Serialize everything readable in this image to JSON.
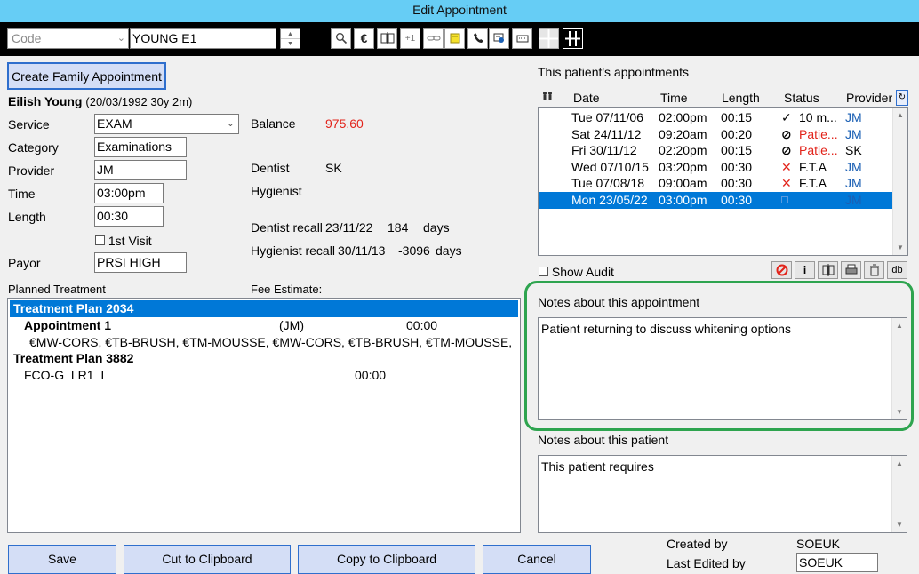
{
  "window": {
    "title": "Edit Appointment"
  },
  "toolbar": {
    "code_placeholder": "Code",
    "patient_search": "YOUNG E1",
    "icons": [
      "search-icon",
      "euro-icon",
      "split-icon",
      "plus-one-icon",
      "link-icon",
      "note-icon",
      "phone-icon",
      "card-icon",
      "keyboard-icon",
      "grid-icon",
      "columns-icon"
    ],
    "euro_glyph": "€",
    "plus_one": "+1"
  },
  "left": {
    "create_family_label": "Create Family Appointment",
    "patient_name": "Eilish Young",
    "patient_dob": "(20/03/1992 30y 2m)",
    "service_label": "Service",
    "service_value": "EXAM",
    "category_label": "Category",
    "category_value": "Examinations",
    "provider_label": "Provider",
    "provider_value": "JM",
    "time_label": "Time",
    "time_value": "03:00pm",
    "length_label": "Length",
    "length_value": "00:30",
    "first_visit_label": "1st Visit",
    "payor_label": "Payor",
    "payor_value": "PRSI HIGH",
    "balance_label": "Balance",
    "balance_value": "975.60",
    "balance_color": "#e2231a",
    "dentist_label": "Dentist",
    "dentist_value": "SK",
    "hygienist_label": "Hygienist",
    "hygienist_value": "",
    "dentist_recall_label": "Dentist recall",
    "dentist_recall_date": "23/11/22",
    "dentist_recall_days": "184",
    "hygienist_recall_label": "Hygienist recall",
    "hygienist_recall_date": "30/11/13",
    "hygienist_recall_days": "-3096",
    "days_label": "days",
    "planned_treatment_label": "Planned Treatment",
    "fee_estimate_label": "Fee Estimate:"
  },
  "treatment": {
    "plan1_title": "Treatment Plan 2034",
    "appt_title": "Appointment 1",
    "appt_provider": "(JM)",
    "appt_time": "00:00",
    "items": "€MW-CORS, €TB-BRUSH, €TM-MOUSSE, €MW-CORS, €TB-BRUSH, €TM-MOUSSE,",
    "plan2_title": "Treatment Plan 3882",
    "plan2_item": "FCO-G  LR1  I",
    "plan2_time": "00:00"
  },
  "appointments": {
    "label": "This patient's appointments",
    "headers": {
      "date": "Date",
      "time": "Time",
      "length": "Length",
      "status": "Status",
      "provider": "Provider"
    },
    "rows": [
      {
        "date": "Tue 07/11/06",
        "time": "02:00pm",
        "length": "00:15",
        "status_icon": "check-icon",
        "status_glyph": "✓",
        "status": "10 m...",
        "status_color": "#000000",
        "provider": "JM",
        "provider_color": "#1a5fb4"
      },
      {
        "date": "Sat 24/11/12",
        "time": "09:20am",
        "length": "00:20",
        "status_icon": "cancel-icon",
        "status_glyph": "⊘",
        "status": "Patie...",
        "status_color": "#e2231a",
        "provider": "JM",
        "provider_color": "#1a5fb4"
      },
      {
        "date": "Fri 30/11/12",
        "time": "02:20pm",
        "length": "00:15",
        "status_icon": "cancel-icon",
        "status_glyph": "⊘",
        "status": "Patie...",
        "status_color": "#e2231a",
        "provider": "SK",
        "provider_color": "#000000"
      },
      {
        "date": "Wed 07/10/15",
        "time": "03:20pm",
        "length": "00:30",
        "status_icon": "x-icon",
        "status_glyph": "✕",
        "status": "F.T.A",
        "status_color": "#000000",
        "provider": "JM",
        "provider_color": "#1a5fb4"
      },
      {
        "date": "Tue 07/08/18",
        "time": "09:00am",
        "length": "00:30",
        "status_icon": "x-icon",
        "status_glyph": "✕",
        "status": "F.T.A",
        "status_color": "#000000",
        "provider": "JM",
        "provider_color": "#1a5fb4"
      },
      {
        "date": "Mon 23/05/22",
        "time": "03:00pm",
        "length": "00:30",
        "status_icon": "empty-box-icon",
        "status_glyph": "",
        "status": "",
        "status_color": "#ffffff",
        "provider": "JM",
        "provider_color": "#1a5fb4",
        "selected": true
      }
    ],
    "show_audit_label": "Show Audit",
    "action_icons": [
      "no-entry-icon",
      "info-icon",
      "split-icon",
      "print-icon",
      "trash-icon",
      "db-icon"
    ],
    "info_glyph": "i",
    "db_glyph": "db"
  },
  "notes": {
    "appointment_label": "Notes about this appointment",
    "appointment_text": "Patient returning to discuss whitening options",
    "patient_label": "Notes about this patient",
    "patient_text": "This patient requires",
    "highlight_color": "#2ea44f"
  },
  "footer": {
    "save": "Save",
    "cut": "Cut to Clipboard",
    "copy": "Copy to Clipboard",
    "cancel": "Cancel",
    "created_by_label": "Created by",
    "created_by_value": "SOEUK",
    "last_edited_label": "Last Edited by",
    "last_edited_value": "SOEUK"
  }
}
